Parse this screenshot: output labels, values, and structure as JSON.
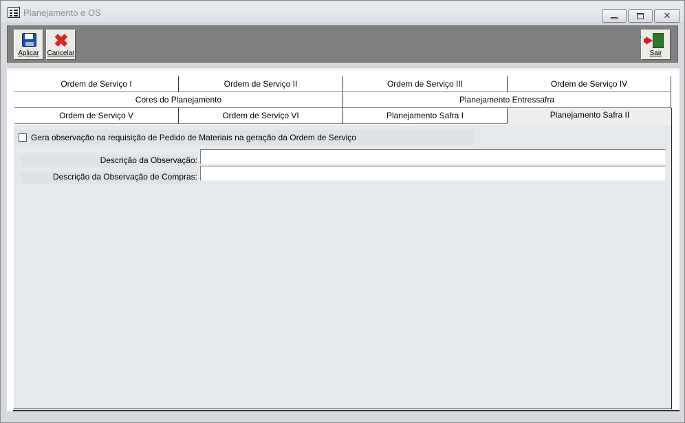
{
  "window": {
    "title": "Planejamento e OS"
  },
  "toolbar": {
    "apply_label": "Aplicar",
    "cancel_label": "Cancelar",
    "exit_label": "Sair"
  },
  "tabs": {
    "row1": [
      "Ordem de Serviço I",
      "Ordem de Serviço II",
      "Ordem de Serviço III",
      "Ordem de Serviço IV"
    ],
    "row2": [
      "Cores do Planejamento",
      "Planejamento Entressafra"
    ],
    "row3": [
      "Ordem de Serviço V",
      "Ordem de Serviço VI",
      "Planejamento Safra I",
      "Planejamento Safra II"
    ],
    "active": "Planejamento Safra II"
  },
  "form": {
    "checkbox_label": "Gera observação na requisição de Pedido de Materiais na geração da Ordem de Serviço",
    "checkbox_checked": false,
    "obs_label": "Descrição da Observação:",
    "obs_value": "",
    "obs_compras_label": "Descrição da Observação de Compras:",
    "obs_compras_value": ""
  }
}
